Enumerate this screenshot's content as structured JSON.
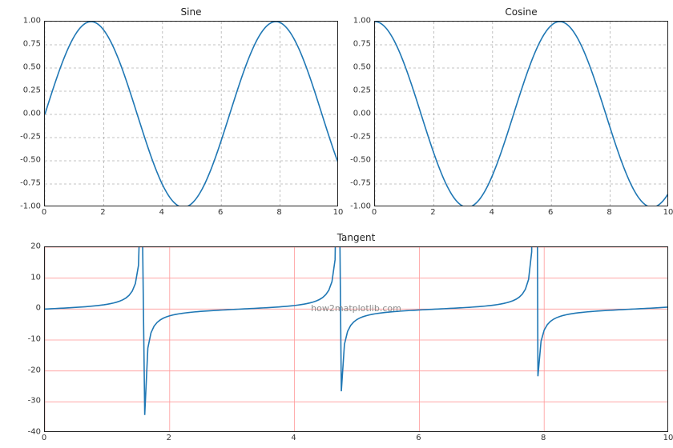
{
  "chart_data": [
    {
      "type": "line",
      "title": "Sine",
      "x_range": [
        0,
        10
      ],
      "y_range": [
        -1.0,
        1.0
      ],
      "x_ticks": [
        0,
        2,
        4,
        6,
        8,
        10
      ],
      "y_ticks": [
        -1.0,
        -0.75,
        -0.5,
        -0.25,
        0.0,
        0.25,
        0.5,
        0.75,
        1.0
      ],
      "function": "sin",
      "grid_color": "gray-dashed"
    },
    {
      "type": "line",
      "title": "Cosine",
      "x_range": [
        0,
        10
      ],
      "y_range": [
        -1.0,
        1.0
      ],
      "x_ticks": [
        0,
        2,
        4,
        6,
        8,
        10
      ],
      "y_ticks": [
        -1.0,
        -0.75,
        -0.5,
        -0.25,
        0.0,
        0.25,
        0.5,
        0.75,
        1.0
      ],
      "function": "cos",
      "grid_color": "gray-dashed"
    },
    {
      "type": "line",
      "title": "Tangent",
      "x_range": [
        0,
        10
      ],
      "y_range": [
        -40,
        20
      ],
      "x_ticks": [
        0,
        2,
        4,
        6,
        8,
        10
      ],
      "y_ticks": [
        -40,
        -30,
        -20,
        -10,
        0,
        10,
        20
      ],
      "function": "tan",
      "grid_color": "pink-solid",
      "watermark": "how2matplotlib.com"
    }
  ],
  "titles": {
    "sine": "Sine",
    "cosine": "Cosine",
    "tangent": "Tangent"
  },
  "xtick_labels": {
    "t0": "0",
    "t2": "2",
    "t4": "4",
    "t6": "6",
    "t8": "8",
    "t10": "10"
  },
  "ytick_labels_unit": {
    "m100": "-1.00",
    "m075": "-0.75",
    "m050": "-0.50",
    "m025": "-0.25",
    "p000": "0.00",
    "p025": "0.25",
    "p050": "0.50",
    "p075": "0.75",
    "p100": "1.00"
  },
  "ytick_labels_tan": {
    "m40": "-40",
    "m30": "-30",
    "m20": "-20",
    "m10": "-10",
    "p0": "0",
    "p10": "10",
    "p20": "20"
  },
  "watermark": "how2matplotlib.com"
}
